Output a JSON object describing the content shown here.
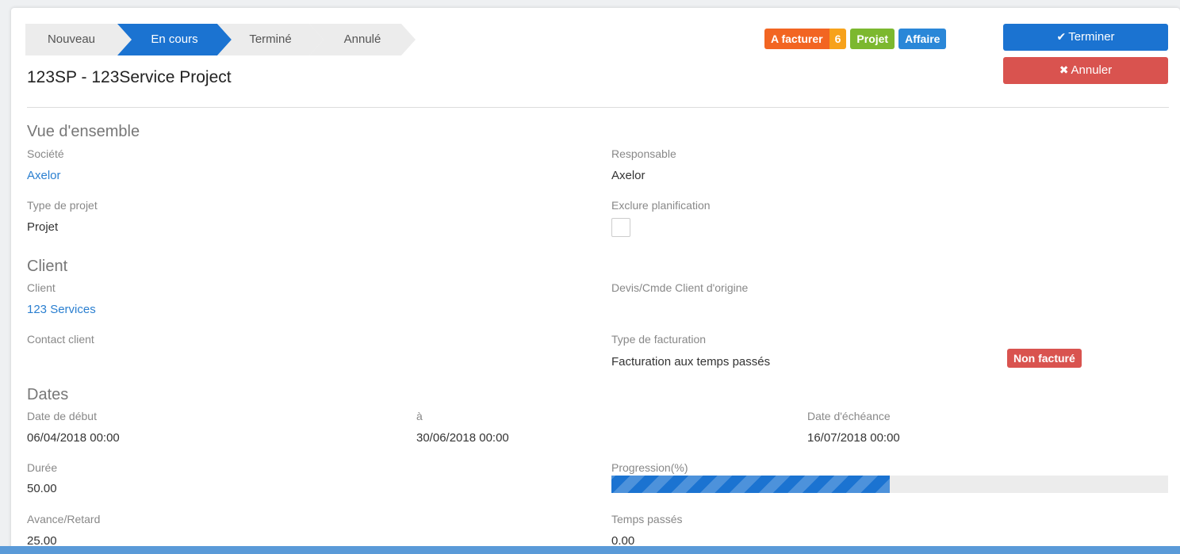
{
  "status_steps": [
    {
      "label": "Nouveau",
      "active": false
    },
    {
      "label": "En cours",
      "active": true
    },
    {
      "label": "Terminé",
      "active": false
    },
    {
      "label": "Annulé",
      "active": false
    }
  ],
  "record_title": "123SP - 123Service Project",
  "badges": {
    "to_invoice_label": "A facturer",
    "to_invoice_count": "6",
    "project_label": "Projet",
    "business_label": "Affaire"
  },
  "actions": {
    "finish_label": "Terminer",
    "cancel_label": "Annuler"
  },
  "overview": {
    "section_title": "Vue d'ensemble",
    "company_label": "Société",
    "company_value": "Axelor",
    "manager_label": "Responsable",
    "manager_value": "Axelor",
    "project_type_label": "Type de projet",
    "project_type_value": "Projet",
    "exclude_planning_label": "Exclure planification",
    "exclude_planning_checked": false
  },
  "client": {
    "section_title": "Client",
    "client_label": "Client",
    "client_value": "123 Services",
    "origin_order_label": "Devis/Cmde Client d'origine",
    "contact_label": "Contact client",
    "invoicing_type_label": "Type de facturation",
    "invoicing_type_value": "Facturation aux temps passés",
    "invoicing_status": "Non facturé"
  },
  "dates": {
    "section_title": "Dates",
    "start_label": "Date de début",
    "start_value": "06/04/2018 00:00",
    "to_label": "à",
    "to_value": "30/06/2018 00:00",
    "due_label": "Date d'échéance",
    "due_value": "16/07/2018 00:00",
    "duration_label": "Durée",
    "duration_value": "50.00",
    "progress_label": "Progression(%)",
    "progress_percent": 50,
    "advance_label": "Avance/Retard",
    "advance_value": "25.00",
    "time_spent_label": "Temps passés",
    "time_spent_value": "0.00"
  },
  "colors": {
    "primary": "#1b73d1",
    "danger": "#d9534f",
    "orange": "#f26522",
    "yellow": "#f7a21b",
    "green": "#7cb82f",
    "link": "#2a7fd0"
  },
  "icons": {
    "finish": "check-icon",
    "cancel": "times-circle-icon"
  }
}
